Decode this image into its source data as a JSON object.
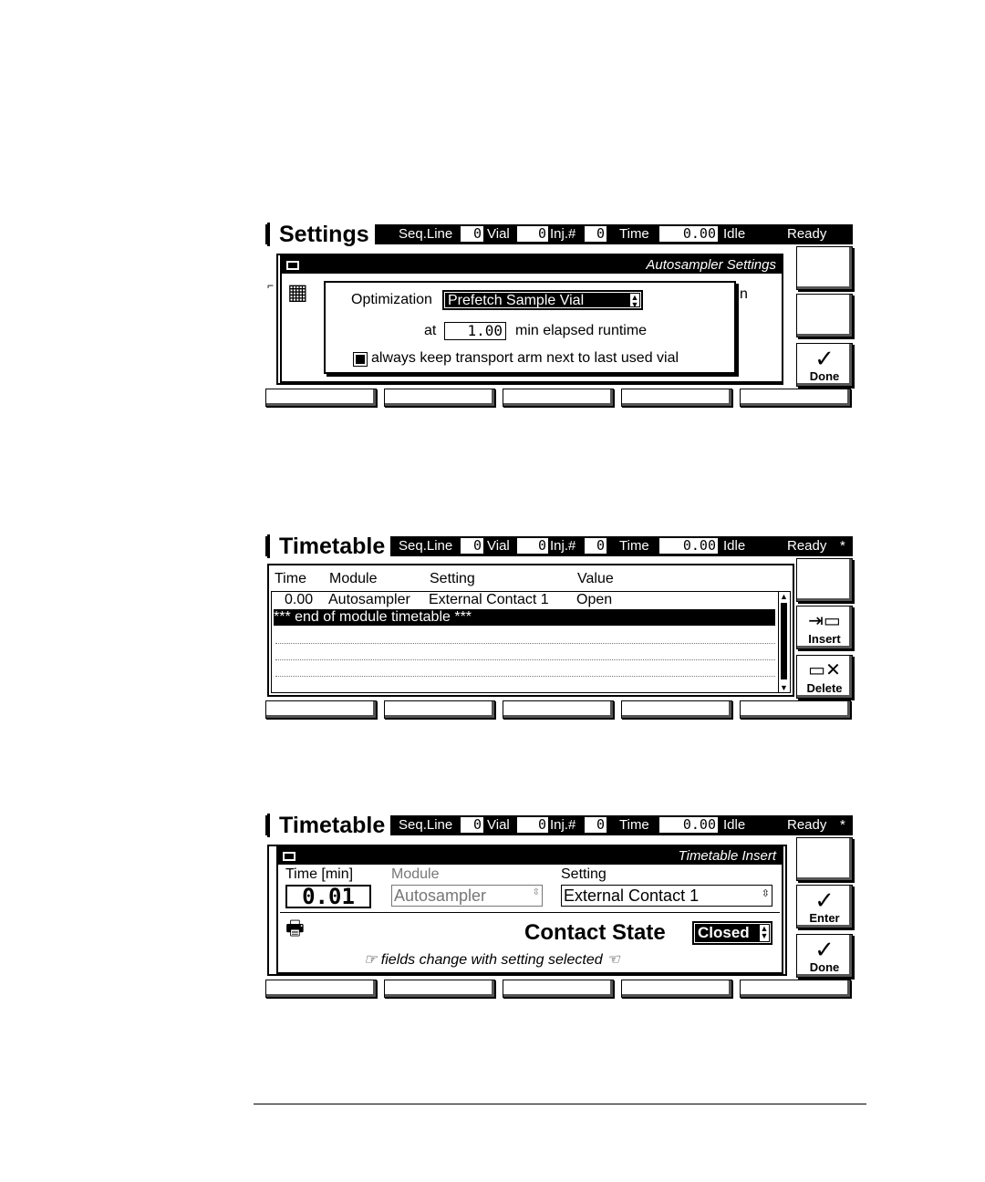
{
  "header_common": {
    "seq_line_label": "Seq.Line",
    "seq_line_value": "0",
    "vial_label": "Vial",
    "vial_value": "0",
    "inj_label": "Inj.#",
    "inj_value": "0",
    "time_label": "Time",
    "time_value": "0.00",
    "idle": "Idle"
  },
  "screen1": {
    "title": "Settings",
    "status": "Ready",
    "dialog_title": "Autosampler Settings",
    "optimization_label": "Optimization",
    "optimization_value": "Prefetch Sample Vial",
    "at_label": "at",
    "at_value": "1.00",
    "at_unit": "min elapsed runtime",
    "keep_arm_label": "always keep transport arm next to last used vial",
    "done_label": "Done",
    "done_icon": "checkmark-icon"
  },
  "screen2": {
    "title": "Timetable",
    "status": "Ready",
    "status_mark": "*",
    "columns": [
      "Time",
      "Module",
      "Setting",
      "Value"
    ],
    "rows": [
      {
        "time": "0.00",
        "module": "Autosampler",
        "setting": "External Contact  1",
        "value": "Open"
      }
    ],
    "end_row": "*** end of module timetable ***",
    "insert_label": "Insert",
    "delete_label": "Delete"
  },
  "screen3": {
    "title": "Timetable",
    "status": "Ready",
    "status_mark": "*",
    "dialog_title": "Timetable Insert",
    "time_label": "Time  [min]",
    "time_value": "0.01",
    "module_label": "Module",
    "module_value": "Autosampler",
    "setting_label": "Setting",
    "setting_value": "External Contact  1",
    "contact_state_label": "Contact State",
    "contact_state_value": "Closed",
    "hint": "fields change with setting selected",
    "enter_label": "Enter",
    "done_label": "Done"
  }
}
